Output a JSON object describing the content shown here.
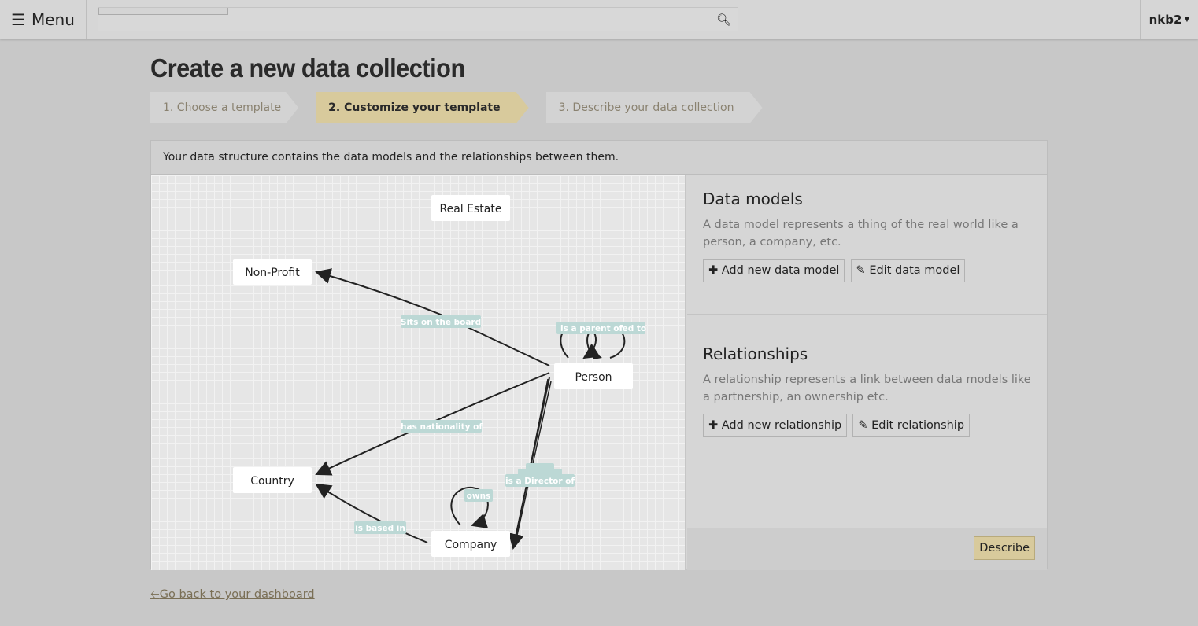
{
  "topbar": {
    "menu_label": "Menu",
    "menu_icon": "hamburger-icon",
    "search_icon": "search-icon",
    "user": "nkb2"
  },
  "page": {
    "title": "Create a new data collection",
    "back_link": "Go back to your dashboard"
  },
  "steps": [
    {
      "label": "1. Choose a template"
    },
    {
      "label": "2. Customize your template",
      "active": true
    },
    {
      "label": "3. Describe your data collection"
    }
  ],
  "panel": {
    "intro": "Your data structure contains the data models and the relationships between them."
  },
  "diagram": {
    "nodes": [
      "Real Estate",
      "Non-Profit",
      "Person",
      "Country",
      "Company"
    ],
    "edges": [
      {
        "label": "Sits on the board",
        "from": "Person",
        "to": "Non-Profit"
      },
      {
        "label": "is a parent of",
        "from": "Person",
        "to": "Person"
      },
      {
        "label": "ied to",
        "from": "Person",
        "to": "Person"
      },
      {
        "label": "has nationality of",
        "from": "Person",
        "to": "Country"
      },
      {
        "label": "is a Director of",
        "from": "Person",
        "to": "Company"
      },
      {
        "label": "owns",
        "from": "Company",
        "to": "Company"
      },
      {
        "label": "is based in",
        "from": "Company",
        "to": "Country"
      }
    ],
    "label_color": "#bcd8d5"
  },
  "data_models": {
    "title": "Data models",
    "description": "A data model represents a thing of the real world like a person, a company, etc.",
    "add": "Add new data model",
    "edit": "Edit data model"
  },
  "relationships": {
    "title": "Relationships",
    "description": "A relationship represents a link between data models like a partnership, an ownership etc.",
    "add": "Add new relationship",
    "edit": "Edit relationship"
  },
  "describe_button": "Describe",
  "accent": "#d8ca9c"
}
